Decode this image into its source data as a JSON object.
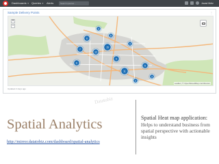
{
  "topbar": {
    "menu": [
      "Dashboards",
      "Queries",
      "Alerts"
    ],
    "search_placeholder": "Search queries...",
    "user": "Javad Metz"
  },
  "panel": {
    "title": "Sample Delivery Points",
    "tools": "⋮",
    "footer": "Updated 2 days ago",
    "attribution": "Leaflet | © OpenStreetMap contributors"
  },
  "map": {
    "markers": [
      {
        "count": "8",
        "kind": "medium"
      },
      {
        "count": "3",
        "kind": "small"
      },
      {
        "count": "5",
        "kind": "small"
      },
      {
        "count": "7",
        "kind": "medium"
      },
      {
        "count": "12",
        "kind": "medium"
      },
      {
        "count": "15",
        "kind": "large"
      },
      {
        "count": "6",
        "kind": "medium"
      },
      {
        "count": "9",
        "kind": "medium"
      },
      {
        "count": "4",
        "kind": "small"
      },
      {
        "count": "11",
        "kind": "large"
      },
      {
        "count": "5",
        "kind": "medium"
      },
      {
        "count": "3",
        "kind": "small"
      },
      {
        "count": "2",
        "kind": "small"
      }
    ],
    "colors": {
      "marker": "#1f6fb4",
      "road": "#f4b77b",
      "urban": "#d5d5d2",
      "green": "#cfe6b8"
    }
  },
  "slide": {
    "watermark": "Datatobiz",
    "title": "Spatial Analytics",
    "url": "http://mirror.datatobiz.com/dashboard/spatial-analytics",
    "desc_head": "Spatial Heat map application:",
    "desc_body": "Helps to understand business from spatial perspective with actionable insights"
  }
}
